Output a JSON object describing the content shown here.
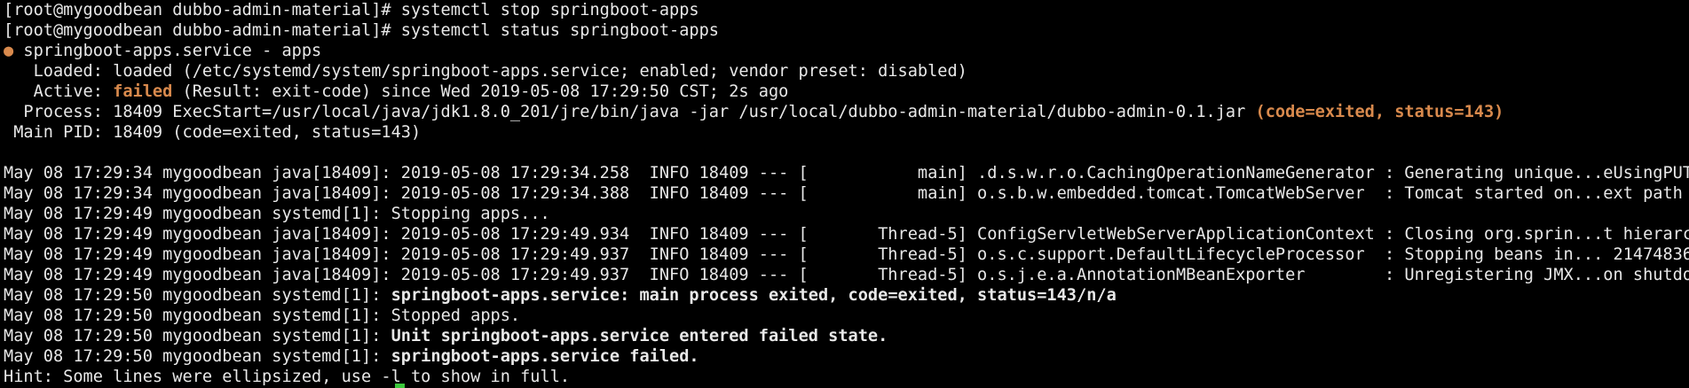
{
  "prompt1": "[root@mygoodbean dubbo-admin-material]# ",
  "cmd1": "systemctl stop springboot-apps",
  "prompt2": "[root@mygoodbean dubbo-admin-material]# ",
  "cmd2": "systemctl status springboot-apps",
  "status": {
    "dot": "●",
    "unit": " springboot-apps.service - apps",
    "loaded": "   Loaded: loaded (/etc/systemd/system/springboot-apps.service; enabled; vendor preset: disabled)",
    "active_prefix": "   Active: ",
    "active_state": "failed",
    "active_rest": " (Result: exit-code) since Wed 2019-05-08 17:29:50 CST; 2s ago",
    "process": "  Process: 18409 ExecStart=/usr/local/java/jdk1.8.0_201/jre/bin/java -jar /usr/local/dubbo-admin-material/dubbo-admin-0.1.jar ",
    "process_status": "(code=exited, status=143)",
    "main_pid": " Main PID: 18409 (code=exited, status=143)"
  },
  "log": [
    {
      "prefix": "May 08 17:29:34 mygoodbean java[18409]: ",
      "msg": "2019-05-08 17:29:34.258  INFO 18409 --- [           main] .d.s.w.r.o.CachingOperationNameGenerator : Generating unique...eUsingPUT_1",
      "bold": false
    },
    {
      "prefix": "May 08 17:29:34 mygoodbean java[18409]: ",
      "msg": "2019-05-08 17:29:34.388  INFO 18409 --- [           main] o.s.b.w.embedded.tomcat.TomcatWebServer  : Tomcat started on...ext path ''",
      "bold": false
    },
    {
      "prefix": "May 08 17:29:49 mygoodbean systemd[1]: ",
      "msg": "Stopping apps...",
      "bold": false
    },
    {
      "prefix": "May 08 17:29:49 mygoodbean java[18409]: ",
      "msg": "2019-05-08 17:29:49.934  INFO 18409 --- [       Thread-5] ConfigServletWebServerApplicationContext : Closing org.sprin...t hierarchy",
      "bold": false
    },
    {
      "prefix": "May 08 17:29:49 mygoodbean java[18409]: ",
      "msg": "2019-05-08 17:29:49.937  INFO 18409 --- [       Thread-5] o.s.c.support.DefaultLifecycleProcessor  : Stopping beans in... 2147483647",
      "bold": false
    },
    {
      "prefix": "May 08 17:29:49 mygoodbean java[18409]: ",
      "msg": "2019-05-08 17:29:49.937  INFO 18409 --- [       Thread-5] o.s.j.e.a.AnnotationMBeanExporter        : Unregistering JMX...on shutdown",
      "bold": false
    },
    {
      "prefix": "May 08 17:29:50 mygoodbean systemd[1]: ",
      "msg": "springboot-apps.service: main process exited, code=exited, status=143/n/a",
      "bold": true
    },
    {
      "prefix": "May 08 17:29:50 mygoodbean systemd[1]: ",
      "msg": "Stopped apps.",
      "bold": false
    },
    {
      "prefix": "May 08 17:29:50 mygoodbean systemd[1]: ",
      "msg": "Unit springboot-apps.service entered failed state.",
      "bold": true
    },
    {
      "prefix": "May 08 17:29:50 mygoodbean systemd[1]: ",
      "msg": "springboot-apps.service failed.",
      "bold": true
    }
  ],
  "hint": "Hint: Some lines were ellipsized, use -l to show in full.",
  "colors": {
    "background": "#000000",
    "foreground": "#e8e8e8",
    "failed": "#d98a4d",
    "cursor": "#3cc83c"
  }
}
